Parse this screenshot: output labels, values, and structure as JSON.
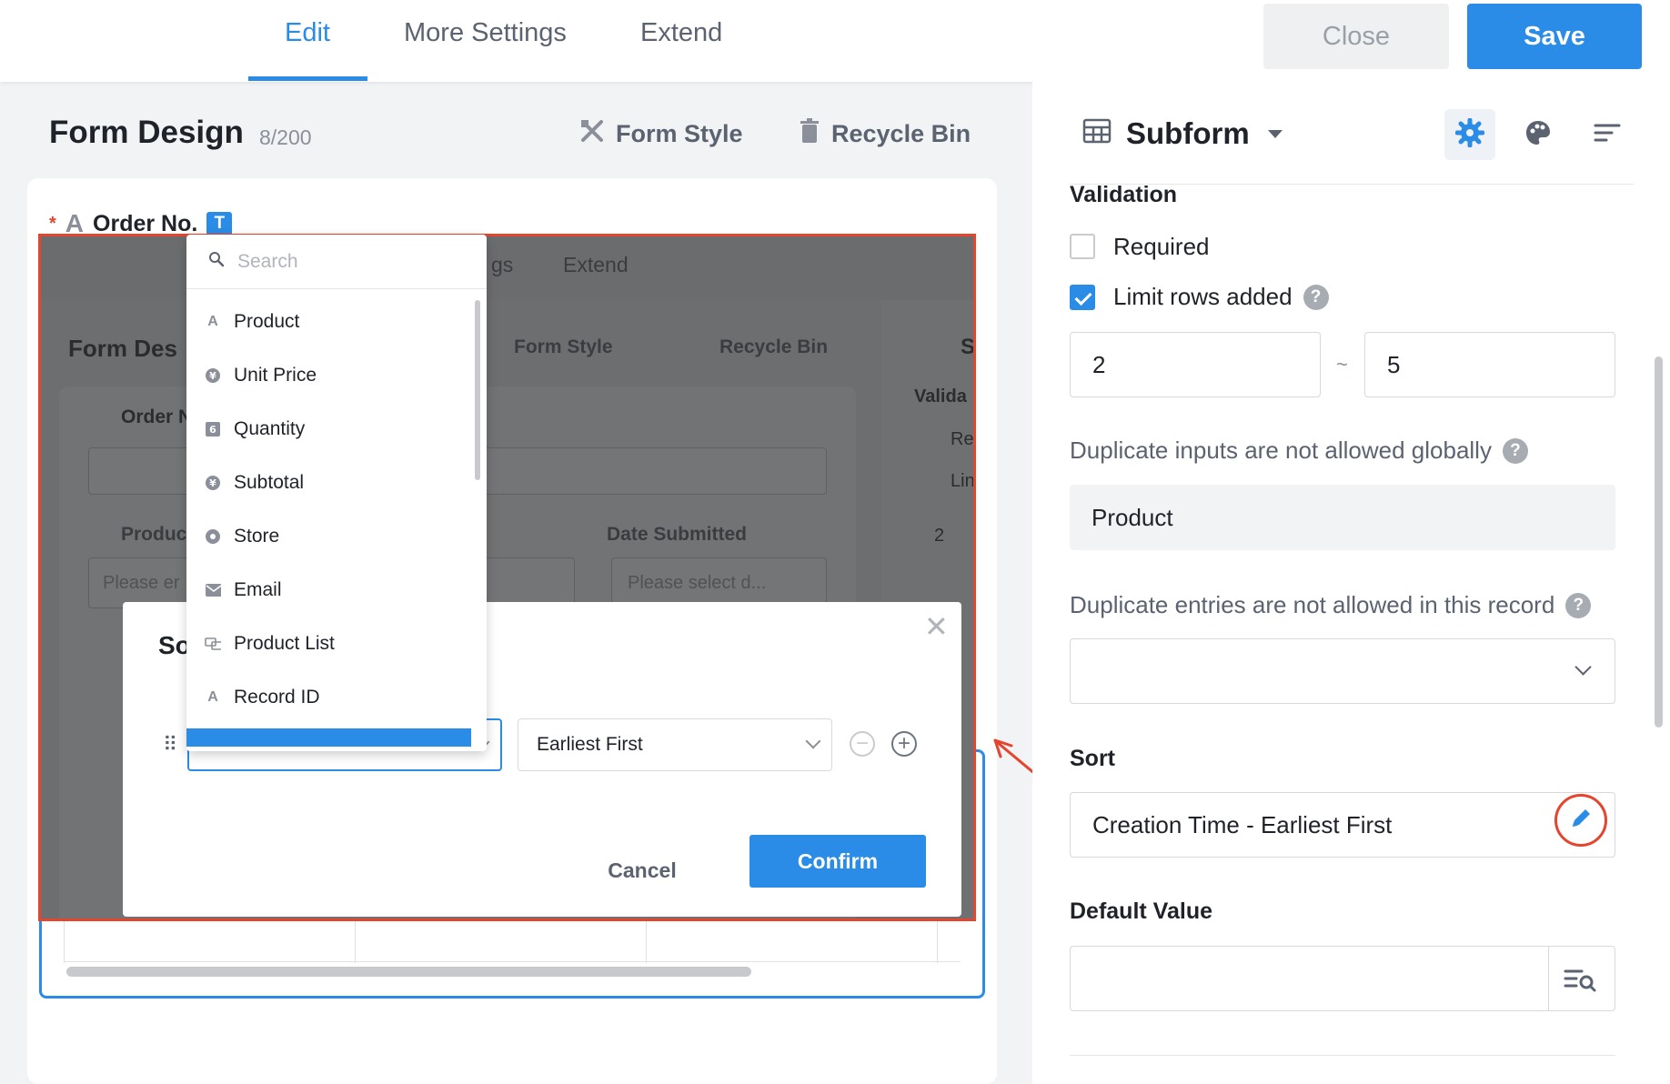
{
  "topbar": {
    "tabs": [
      {
        "label": "Edit",
        "active": true
      },
      {
        "label": "More Settings",
        "active": false
      },
      {
        "label": "Extend",
        "active": false
      }
    ],
    "close_label": "Close",
    "save_label": "Save",
    "accent_color": "#2a8ce6"
  },
  "form_design": {
    "title": "Form Design",
    "count": "8/200",
    "form_style_label": "Form Style",
    "recycle_bin_label": "Recycle Bin",
    "order_no_label": "Order No.",
    "order_no_type_badge": "T"
  },
  "embedded_screenshot": {
    "tab_fragment": "gs",
    "tab_extend": "Extend",
    "form_title_fragment": "Form Des",
    "form_style_label": "Form Style",
    "recycle_bin_label": "Recycle Bin",
    "order_fragment": "Order N",
    "product_fragment": "Produc",
    "date_submitted_label": "Date Submitted",
    "date_placeholder": "Please select d...",
    "please_fragment": "Please er",
    "right_panel_letter": "S",
    "validation_fragment": "Valida",
    "required_fragment": "Re",
    "limit_fragment": "Lin",
    "number_value": "2"
  },
  "field_dropdown": {
    "search_placeholder": "Search",
    "items": [
      {
        "label": "Product",
        "icon": "text-icon"
      },
      {
        "label": "Unit Price",
        "icon": "currency-icon"
      },
      {
        "label": "Quantity",
        "icon": "number-icon"
      },
      {
        "label": "Subtotal",
        "icon": "currency-icon"
      },
      {
        "label": "Store",
        "icon": "radio-icon"
      },
      {
        "label": "Email",
        "icon": "email-icon"
      },
      {
        "label": "Product List",
        "icon": "link-icon"
      },
      {
        "label": "Record ID",
        "icon": "text-icon"
      }
    ]
  },
  "sort_dialog": {
    "title_fragment": "So",
    "order_value": "Earliest First",
    "cancel_label": "Cancel",
    "confirm_label": "Confirm"
  },
  "right_panel": {
    "component_name": "Subform",
    "validation_heading": "Validation",
    "required_label": "Required",
    "required_checked": false,
    "limit_rows_label": "Limit rows added",
    "limit_rows_checked": true,
    "limit_min": "2",
    "limit_max": "5",
    "range_separator": "~",
    "dup_global_label": "Duplicate inputs are not allowed globally",
    "dup_global_value": "Product",
    "dup_record_label": "Duplicate entries are not allowed in this record",
    "dup_record_value": "",
    "sort_heading": "Sort",
    "sort_value": "Creation Time - Earliest First",
    "default_value_heading": "Default Value",
    "default_value": ""
  },
  "annotation_color": "#e5442d"
}
